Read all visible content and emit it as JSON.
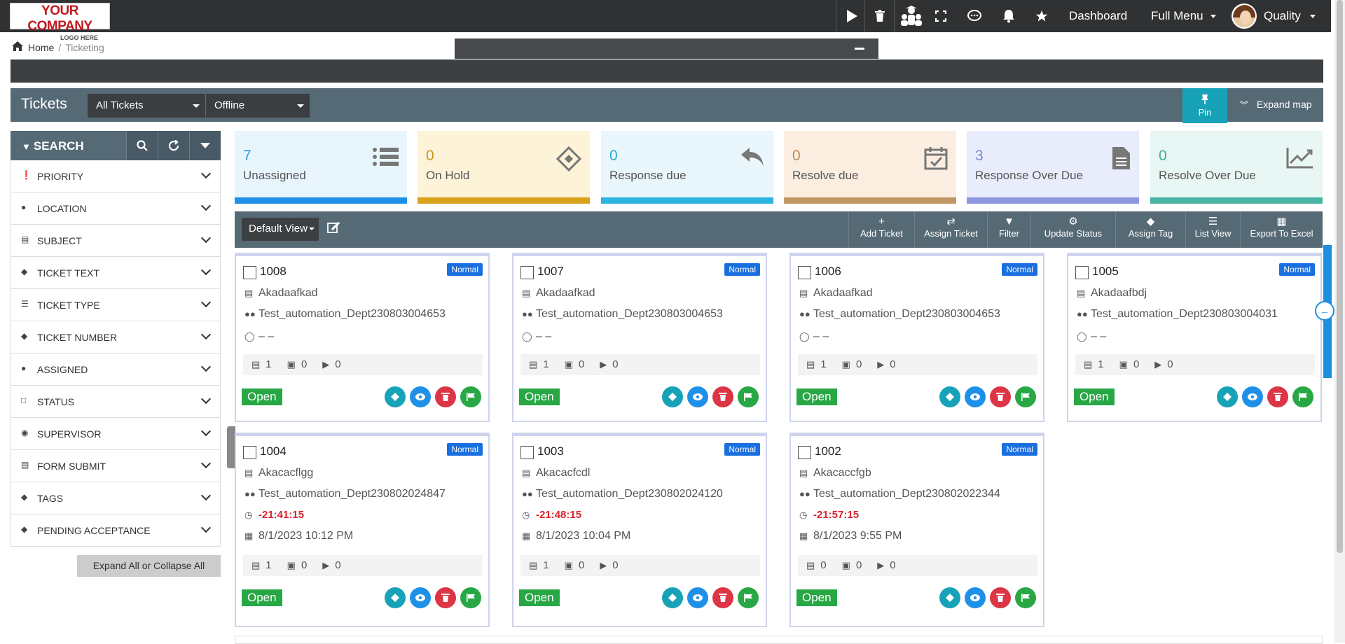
{
  "logo": {
    "line1": "YOUR COMPANY",
    "line2": "LOGO HERE"
  },
  "topbar": {
    "icons": [
      "play-icon",
      "trash-icon",
      "team-icon",
      "fullscreen-icon",
      "chat-icon",
      "bell-icon",
      "star-icon"
    ],
    "dashboard": "Dashboard",
    "full_menu": "Full Menu",
    "user": "Quality"
  },
  "breadcrumb": {
    "home": "Home",
    "sep": "/",
    "current": "Ticketing"
  },
  "header": {
    "title": "Tickets",
    "filter1": "All Tickets",
    "filter2": "Offline",
    "pin": "Pin",
    "expand_map": "Expand map"
  },
  "sidebar": {
    "search_label": "SEARCH",
    "filters": [
      {
        "label": "PRIORITY",
        "icon": "exclamation-icon"
      },
      {
        "label": "LOCATION",
        "icon": "pin-icon"
      },
      {
        "label": "SUBJECT",
        "icon": "id-card-icon"
      },
      {
        "label": "TICKET TEXT",
        "icon": "tag-icon"
      },
      {
        "label": "TICKET TYPE",
        "icon": "list-icon"
      },
      {
        "label": "TICKET NUMBER",
        "icon": "tag-icon"
      },
      {
        "label": "ASSIGNED",
        "icon": "user-icon"
      },
      {
        "label": "STATUS",
        "icon": "document-icon"
      },
      {
        "label": "SUPERVISOR",
        "icon": "user-circle-icon"
      },
      {
        "label": "FORM SUBMIT",
        "icon": "form-icon"
      },
      {
        "label": "TAGS",
        "icon": "tags-icon"
      },
      {
        "label": "PENDING ACCEPTANCE",
        "icon": "tag-icon"
      }
    ],
    "expand_all": "Expand All or Collapse All"
  },
  "stats": [
    {
      "value": "7",
      "label": "Unassigned",
      "icon": "list-icon",
      "bg": "#e9f5fd",
      "bar": "#1e90e8",
      "num_color": "#2f95d8"
    },
    {
      "value": "0",
      "label": "On Hold",
      "icon": "ticket-icon",
      "bg": "#fdf3d8",
      "bar": "#d9a21b",
      "num_color": "#c99a1f"
    },
    {
      "value": "0",
      "label": "Response due",
      "icon": "reply-icon",
      "bg": "#e9f6fb",
      "bar": "#2cb3e0",
      "num_color": "#2aa6d3"
    },
    {
      "value": "0",
      "label": "Resolve due",
      "icon": "calendar-check-icon",
      "bg": "#fbeee1",
      "bar": "#c19763",
      "num_color": "#b88a55"
    },
    {
      "value": "3",
      "label": "Response Over Due",
      "icon": "file-icon",
      "bg": "#e9ecfb",
      "bar": "#8d97e0",
      "num_color": "#7b86d4"
    },
    {
      "value": "0",
      "label": "Resolve Over Due",
      "icon": "chart-icon",
      "bg": "#e8f6f4",
      "bar": "#4bb3a4",
      "num_color": "#46a99b"
    }
  ],
  "toolbar": {
    "default_view": "Default View",
    "buttons": [
      "Add Ticket",
      "Assign Ticket",
      "Filter",
      "Update Status",
      "Assign Tag",
      "List View",
      "Export To Excel"
    ]
  },
  "cards": [
    {
      "id": "1008",
      "priority": "Normal",
      "subject": "Akadaafkad",
      "dept": "Test_automation_Dept230803004653",
      "assignee": "– –",
      "files": "1",
      "images": "0",
      "videos": "0",
      "status": "Open"
    },
    {
      "id": "1007",
      "priority": "Normal",
      "subject": "Akadaafkad",
      "dept": "Test_automation_Dept230803004653",
      "assignee": "– –",
      "files": "1",
      "images": "0",
      "videos": "0",
      "status": "Open"
    },
    {
      "id": "1006",
      "priority": "Normal",
      "subject": "Akadaafkad",
      "dept": "Test_automation_Dept230803004653",
      "assignee": "– –",
      "files": "1",
      "images": "0",
      "videos": "0",
      "status": "Open"
    },
    {
      "id": "1005",
      "priority": "Normal",
      "subject": "Akadaafbdj",
      "dept": "Test_automation_Dept230803004031",
      "assignee": "– –",
      "files": "1",
      "images": "0",
      "videos": "0",
      "status": "Open"
    },
    {
      "id": "1004",
      "priority": "Normal",
      "subject": "Akacacflgg",
      "dept": "Test_automation_Dept230802024847",
      "timer": "-21:41:15",
      "date": "8/1/2023 10:12 PM",
      "files": "1",
      "images": "0",
      "videos": "0",
      "status": "Open"
    },
    {
      "id": "1003",
      "priority": "Normal",
      "subject": "Akacacfcdl",
      "dept": "Test_automation_Dept230802024120",
      "timer": "-21:48:15",
      "date": "8/1/2023 10:04 PM",
      "files": "1",
      "images": "0",
      "videos": "0",
      "status": "Open"
    },
    {
      "id": "1002",
      "priority": "Normal",
      "subject": "Akacaccfgb",
      "dept": "Test_automation_Dept230802022344",
      "timer": "-21:57:15",
      "date": "8/1/2023 9:55 PM",
      "files": "0",
      "images": "0",
      "videos": "0",
      "status": "Open"
    }
  ],
  "action_colors": {
    "tag": "#17a2b8",
    "view": "#1e90e8",
    "delete": "#dc3545",
    "flag": "#28a745"
  }
}
